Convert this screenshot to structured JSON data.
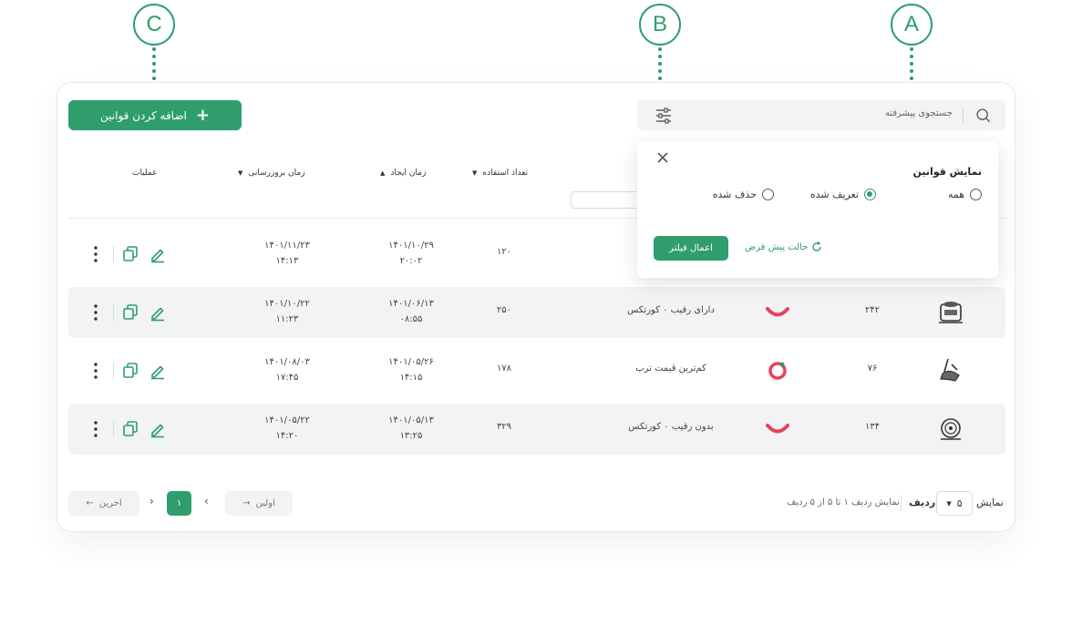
{
  "callouts": [
    "A",
    "B",
    "C"
  ],
  "toolbar": {
    "add_label": "اضافه کردن قوانین"
  },
  "search": {
    "placeholder": "جستجوی پیشرفته"
  },
  "table": {
    "headers": {
      "operations": "عملیات",
      "updated": "زمان بروزرسانی",
      "created": "زمان ایجاد",
      "usage": "تعداد استفاده"
    },
    "rows": [
      {
        "updated_date": "۱۴۰۱/۱۱/۲۳",
        "updated_time": "۱۴:۱۳",
        "created_date": "۱۴۰۱/۱۰/۲۹",
        "created_time": "۲۰:۰۲",
        "usage": "۱۲۰",
        "label": "",
        "number": "",
        "mark": "none",
        "alt": false
      },
      {
        "updated_date": "۱۴۰۱/۱۰/۲۲",
        "updated_time": "۱۱:۲۳",
        "created_date": "۱۴۰۱/۰۶/۱۳",
        "created_time": "۰۸:۵۵",
        "usage": "۲۵۰",
        "label": "دارای رقیب ۰ کورتکس",
        "number": "۲۴۲",
        "mark": "smile",
        "alt": true
      },
      {
        "updated_date": "۱۴۰۱/۰۸/۰۳",
        "updated_time": "۱۷:۴۵",
        "created_date": "۱۴۰۱/۰۵/۲۶",
        "created_time": "۱۴:۱۵",
        "usage": "۱۷۸",
        "label": "کم‌ترین قیمت ترب",
        "number": "۷۶",
        "mark": "ring",
        "alt": false
      },
      {
        "updated_date": "۱۴۰۱/۰۵/۲۲",
        "updated_time": "۱۴:۲۰",
        "created_date": "۱۴۰۱/۰۵/۱۳",
        "created_time": "۱۳:۲۵",
        "usage": "۳۲۹",
        "label": "بدون رقیب ۰ کورتکس",
        "number": "۱۳۴",
        "mark": "smile",
        "alt": true
      }
    ]
  },
  "filter_panel": {
    "title": "نمایش قوانین",
    "options": [
      "همه",
      "تعریف شده",
      "حذف شده"
    ],
    "selected": "تعریف شده",
    "apply_label": "اعمال فیلتر",
    "reset_label": "حالت پیش فرض"
  },
  "pagination": {
    "last_label": "اخرین",
    "first_label": "اولین",
    "current_page": "۱",
    "summary": "نمایش ردیف ۱ تا ۵ از ۵ ردیف",
    "rows_label": "ردیف",
    "show_label": "نمایش",
    "page_size": "۵"
  },
  "colors": {
    "accent": "#2f9e6c",
    "mark_red": "#e8415a",
    "row_alt": "#f1f3f5"
  }
}
